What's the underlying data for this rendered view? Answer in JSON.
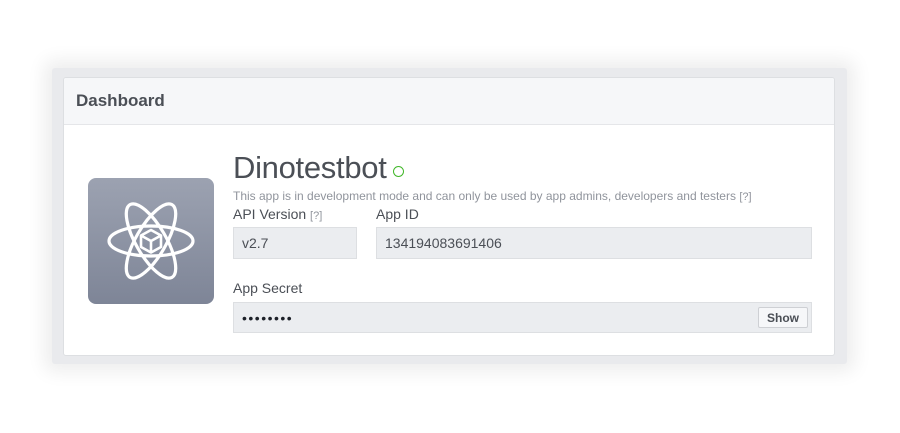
{
  "header": {
    "title": "Dashboard"
  },
  "app": {
    "name": "Dinotestbot",
    "status_icon": "status-circle-icon",
    "status_color": "#42b72a",
    "mode_text": "This app is in development mode and can only be used by app admins, developers and testers",
    "mode_help": "[?]",
    "icon": "atom-cube-icon"
  },
  "fields": {
    "api_version": {
      "label": "API Version",
      "help": "[?]",
      "value": "v2.7"
    },
    "app_id": {
      "label": "App ID",
      "value": "134194083691406"
    },
    "app_secret": {
      "label": "App Secret",
      "value": "••••••••",
      "show_label": "Show"
    }
  }
}
